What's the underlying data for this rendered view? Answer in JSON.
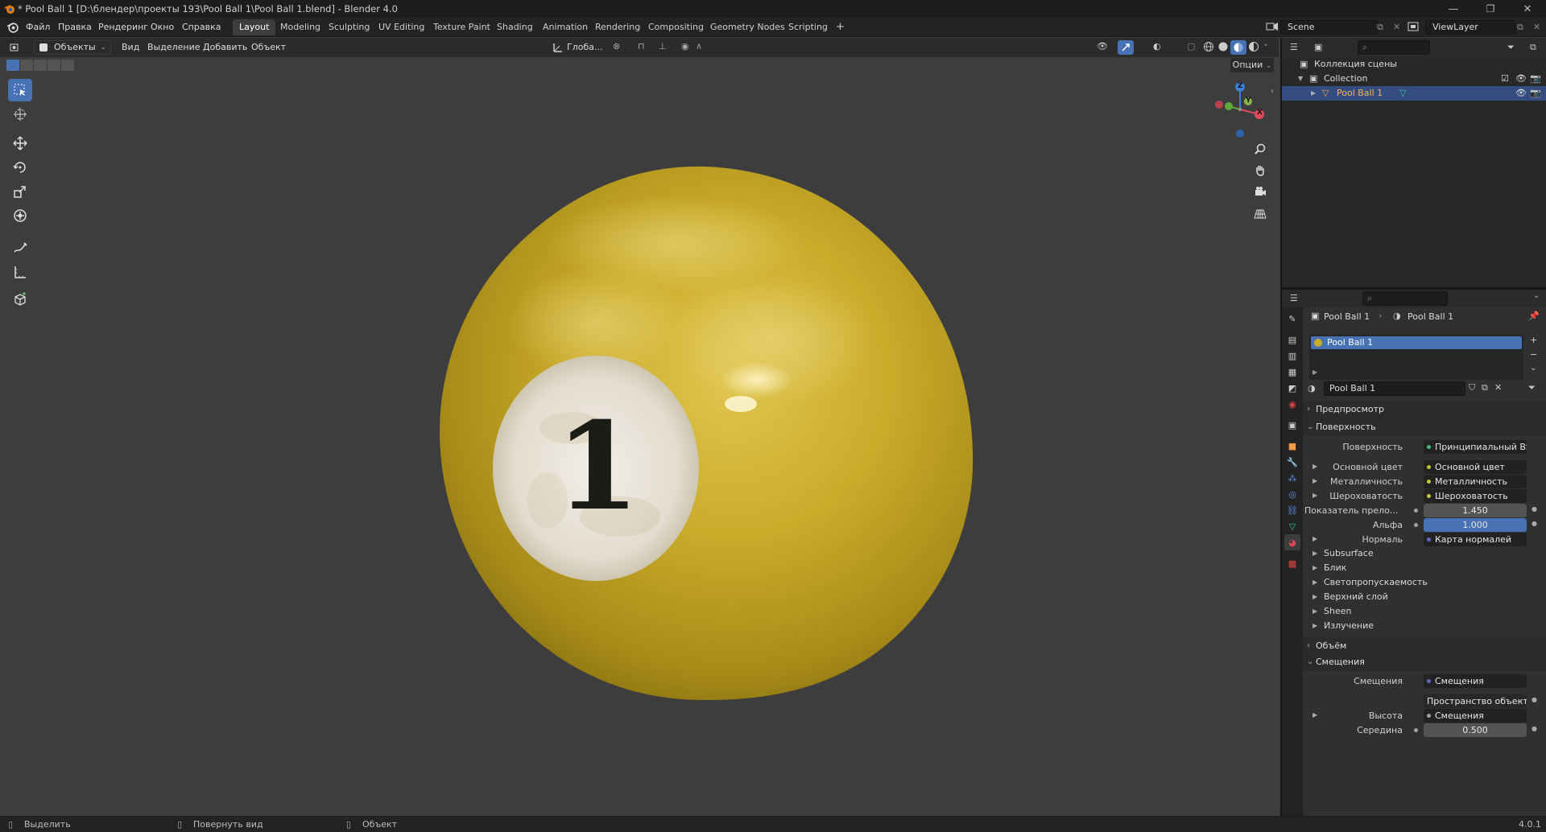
{
  "window": {
    "title": "* Pool Ball 1 [D:\\блендер\\проекты 193\\Pool Ball 1\\Pool Ball 1.blend] - Blender 4.0",
    "minimize": "—",
    "maximize": "❐",
    "close": "✕"
  },
  "menu": [
    "Файл",
    "Правка",
    "Рендеринг",
    "Окно",
    "Справка"
  ],
  "workspaces": {
    "active": "Layout",
    "tabs": [
      "Layout",
      "Modeling",
      "Sculpting",
      "UV Editing",
      "Texture Paint",
      "Shading",
      "Animation",
      "Rendering",
      "Compositing",
      "Geometry Nodes",
      "Scripting"
    ],
    "add": "+"
  },
  "scene": {
    "name": "Scene",
    "view_layer": "ViewLayer"
  },
  "viewport": {
    "mode": "Объекты",
    "menus": [
      "Вид",
      "Выделение",
      "Добавить",
      "Объект"
    ],
    "transform_orientation": "Глоба...",
    "options": "Опции",
    "shading_mode": "Material Preview",
    "gizmo_axes": {
      "x": "X",
      "y": "Y",
      "z": "Z"
    },
    "ball": {
      "number": "1",
      "base_color": "#c9ac2a"
    }
  },
  "toolbar": [
    "select-box",
    "cursor",
    "move",
    "rotate",
    "scale",
    "transform",
    "annotate",
    "measure",
    "add-cube"
  ],
  "outliner": {
    "root": "Коллекция сцены",
    "collection": "Collection",
    "object": "Pool Ball 1"
  },
  "properties": {
    "breadcrumb": [
      "Pool Ball 1",
      "Pool Ball 1"
    ],
    "material_slot": "Pool Ball 1",
    "material_name": "Pool Ball 1",
    "sections": {
      "preview": "Предпросмотр",
      "surface": "Поверхность",
      "volume": "Объём",
      "displacement": "Смещения"
    },
    "surface": {
      "shader_label": "Поверхность",
      "shader_value": "Принципиальный BSDF",
      "rows": [
        {
          "label": "Основной цвет",
          "value": "Основной цвет",
          "dot": "#c7c729"
        },
        {
          "label": "Металличность",
          "value": "Металличность",
          "dot": "#c7c729"
        },
        {
          "label": "Шероховатость",
          "value": "Шероховатость",
          "dot": "#c7c729"
        }
      ],
      "ior_label": "Показатель прело...",
      "ior_value": "1.450",
      "alpha_label": "Альфа",
      "alpha_value": "1.000",
      "normal_label": "Нормаль",
      "normal_value": "Карта нормалей",
      "subpanels": [
        "Subsurface",
        "Блик",
        "Светопропускаемость",
        "Верхний слой",
        "Sheen",
        "Излучение"
      ]
    },
    "displacement": {
      "label": "Смещения",
      "value": "Смещения",
      "space": "Пространство объекта",
      "height_label": "Высота",
      "height_value": "Смещения",
      "midlevel_label": "Середина",
      "midlevel_value": "0.500"
    }
  },
  "statusbar": {
    "select": "Выделить",
    "rotate_view": "Повернуть вид",
    "object": "Объект",
    "version": "4.0.1"
  }
}
